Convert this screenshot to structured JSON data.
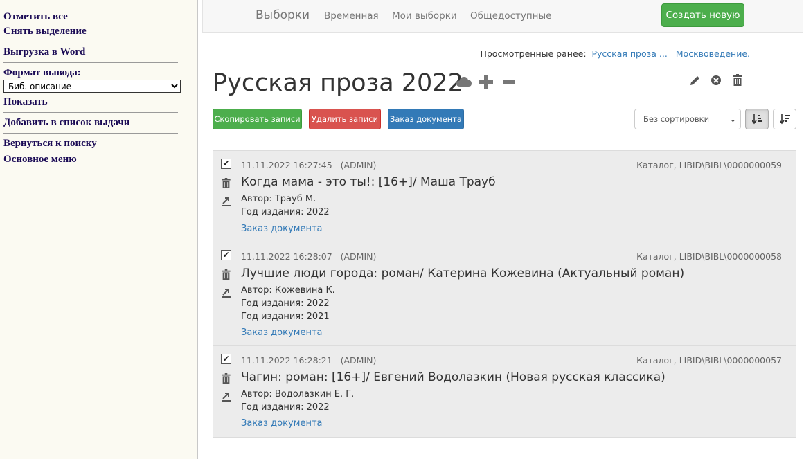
{
  "left_menu": {
    "select_all": "Отметить все",
    "deselect": "Снять выделение",
    "export_word": "Выгрузка в Word",
    "format_label": "Формат вывода:",
    "format_value": "Биб. описание",
    "show": "Показать",
    "add_to_issue": "Добавить в список выдачи",
    "back_to_search": "Вернуться к поиску",
    "main_menu": "Основное меню"
  },
  "navbar": {
    "brand": "Выборки",
    "items": [
      "Временная",
      "Мои выборки",
      "Общедоступные"
    ],
    "create_button": "Создать новую"
  },
  "previously_viewed": {
    "label": "Просмотренные ранее:",
    "links": [
      "Русская проза ...",
      "Москвоведение."
    ]
  },
  "page_title": "Русская проза 2022",
  "actions": {
    "copy": "Скопировать записи",
    "delete": "Удалить записи",
    "order": "Заказ документа"
  },
  "sort": {
    "value": "Без сортировки"
  },
  "records": [
    {
      "datetime": "11.11.2022 16:27:45",
      "user": "(ADMIN)",
      "catalog": "Каталог, LIBID\\BIBL\\0000000059",
      "title": "Когда мама - это ты!: [16+]/ Маша Трауб",
      "lines": [
        "Автор: Трауб М.",
        "Год издания: 2022"
      ],
      "order_link": "Заказ документа"
    },
    {
      "datetime": "11.11.2022 16:28:07",
      "user": "(ADMIN)",
      "catalog": "Каталог, LIBID\\BIBL\\0000000058",
      "title": "Лучшие люди города: роман/ Катерина Кожевина (Актуальный роман)",
      "lines": [
        "Автор: Кожевина К.",
        "Год издания: 2022",
        "Год издания: 2021"
      ],
      "order_link": "Заказ документа"
    },
    {
      "datetime": "11.11.2022 16:28:21",
      "user": "(ADMIN)",
      "catalog": "Каталог, LIBID\\BIBL\\0000000057",
      "title": "Чагин: роман: [16+]/ Евгений Водолазкин (Новая русская классика)",
      "lines": [
        "Автор: Водолазкин Е. Г.",
        "Год издания: 2022"
      ],
      "order_link": "Заказ документа"
    }
  ],
  "colors": {
    "green": "#4cae4c",
    "red": "#d9534f",
    "blue": "#337ab7",
    "left_bg": "#fbfaf2",
    "left_link": "#1a0a55"
  }
}
